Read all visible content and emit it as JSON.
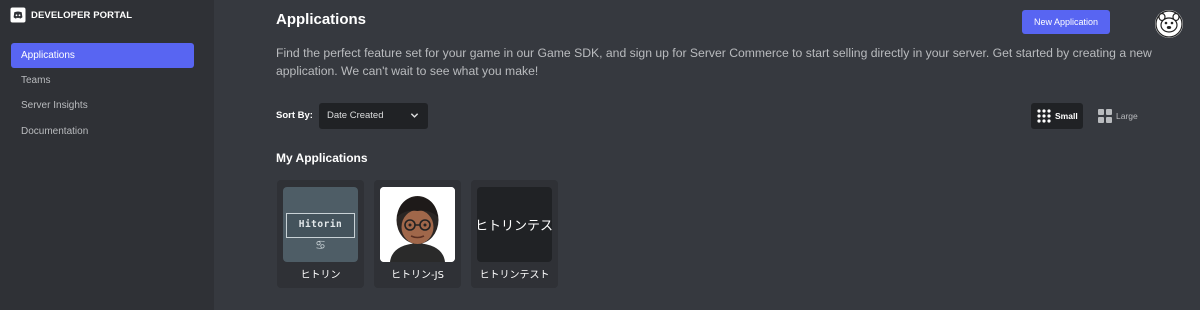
{
  "sidebar": {
    "brand": "DEVELOPER PORTAL",
    "items": [
      {
        "label": "Applications",
        "active": true
      },
      {
        "label": "Teams",
        "active": false
      },
      {
        "label": "Server Insights",
        "active": false
      },
      {
        "label": "Documentation",
        "active": false
      }
    ]
  },
  "header": {
    "title": "Applications",
    "new_button": "New Application"
  },
  "intro": "Find the perfect feature set for your game in our Game SDK, and sign up for Server Commerce to start selling directly in your server. Get started by creating a new application. We can't wait to see what you make!",
  "sort": {
    "label": "Sort By:",
    "selected": "Date Created"
  },
  "view": {
    "small": "Small",
    "large": "Large",
    "selected": "small"
  },
  "section": {
    "title": "My Applications"
  },
  "apps": [
    {
      "name": "ヒトリン",
      "thumb_text": "Hitorin",
      "thumb_symbol": "♋"
    },
    {
      "name": "ヒトリン-JS"
    },
    {
      "name": "ヒトリンテスト",
      "thumb_text": "ヒトリンテスト"
    }
  ],
  "colors": {
    "accent": "#5865f2",
    "sidebar_bg": "#2f3136",
    "main_bg": "#36393f",
    "input_bg": "#202225"
  }
}
